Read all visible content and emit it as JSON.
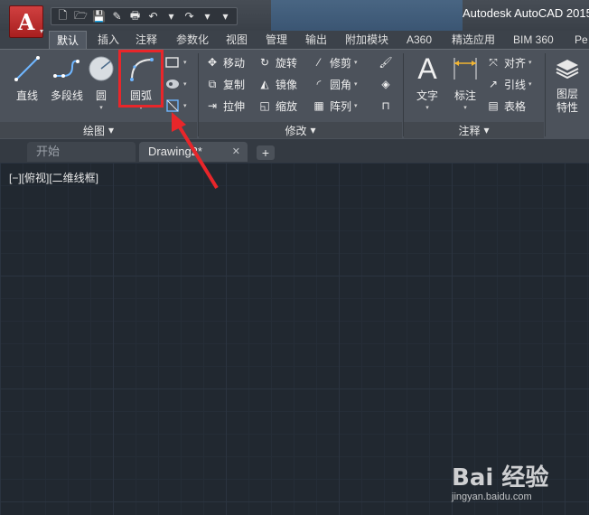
{
  "app": {
    "title": "Autodesk AutoCAD 2015",
    "logo_letter": "A",
    "caret": "▾"
  },
  "quick_access": [
    {
      "name": "new-icon",
      "glyph": "🗋"
    },
    {
      "name": "open-icon",
      "glyph": "🗁"
    },
    {
      "name": "save-icon",
      "glyph": "💾"
    },
    {
      "name": "saveas-icon",
      "glyph": "✎"
    },
    {
      "name": "print-icon",
      "glyph": "🖶"
    },
    {
      "name": "undo-icon",
      "glyph": "↶"
    },
    {
      "name": "undo-dropdown",
      "glyph": "▾"
    },
    {
      "name": "redo-icon",
      "glyph": "↷"
    },
    {
      "name": "redo-dropdown",
      "glyph": "▾"
    },
    {
      "name": "customize-icon",
      "glyph": "▾"
    }
  ],
  "tabs": [
    "默认",
    "插入",
    "注释",
    "参数化",
    "视图",
    "管理",
    "输出",
    "附加模块",
    "A360",
    "精选应用",
    "BIM 360",
    "Pe"
  ],
  "panels": {
    "draw": {
      "footer": "绘图",
      "tools": [
        {
          "label": "直线",
          "icon": "line-icon"
        },
        {
          "label": "多段线",
          "icon": "polyline-icon"
        },
        {
          "label": "圆",
          "icon": "circle-icon"
        },
        {
          "label": "圆弧",
          "icon": "arc-icon"
        }
      ]
    },
    "modify": {
      "footer": "修改",
      "rows": [
        [
          "移动",
          "旋转",
          "修剪"
        ],
        [
          "复制",
          "镜像",
          "圆角"
        ],
        [
          "拉伸",
          "缩放",
          "阵列"
        ]
      ]
    },
    "annotation": {
      "footer": "注释",
      "big_tools": [
        "文字",
        "标注"
      ],
      "small_tools": [
        "对齐",
        "引线",
        "表格"
      ]
    },
    "layers": {
      "big_tool": "图层特性"
    }
  },
  "doc_tabs": {
    "start": "开始",
    "drawing": "Drawing2*",
    "close": "✕",
    "new": "+"
  },
  "viewport_label": "[−][俯视][二维线框]",
  "watermark": {
    "logo": "Bai 经验",
    "url": "jingyan.baidu.com"
  },
  "colors": {
    "highlight": "#e8262a",
    "arrow": "#e8262a",
    "canvas": "#212830"
  }
}
